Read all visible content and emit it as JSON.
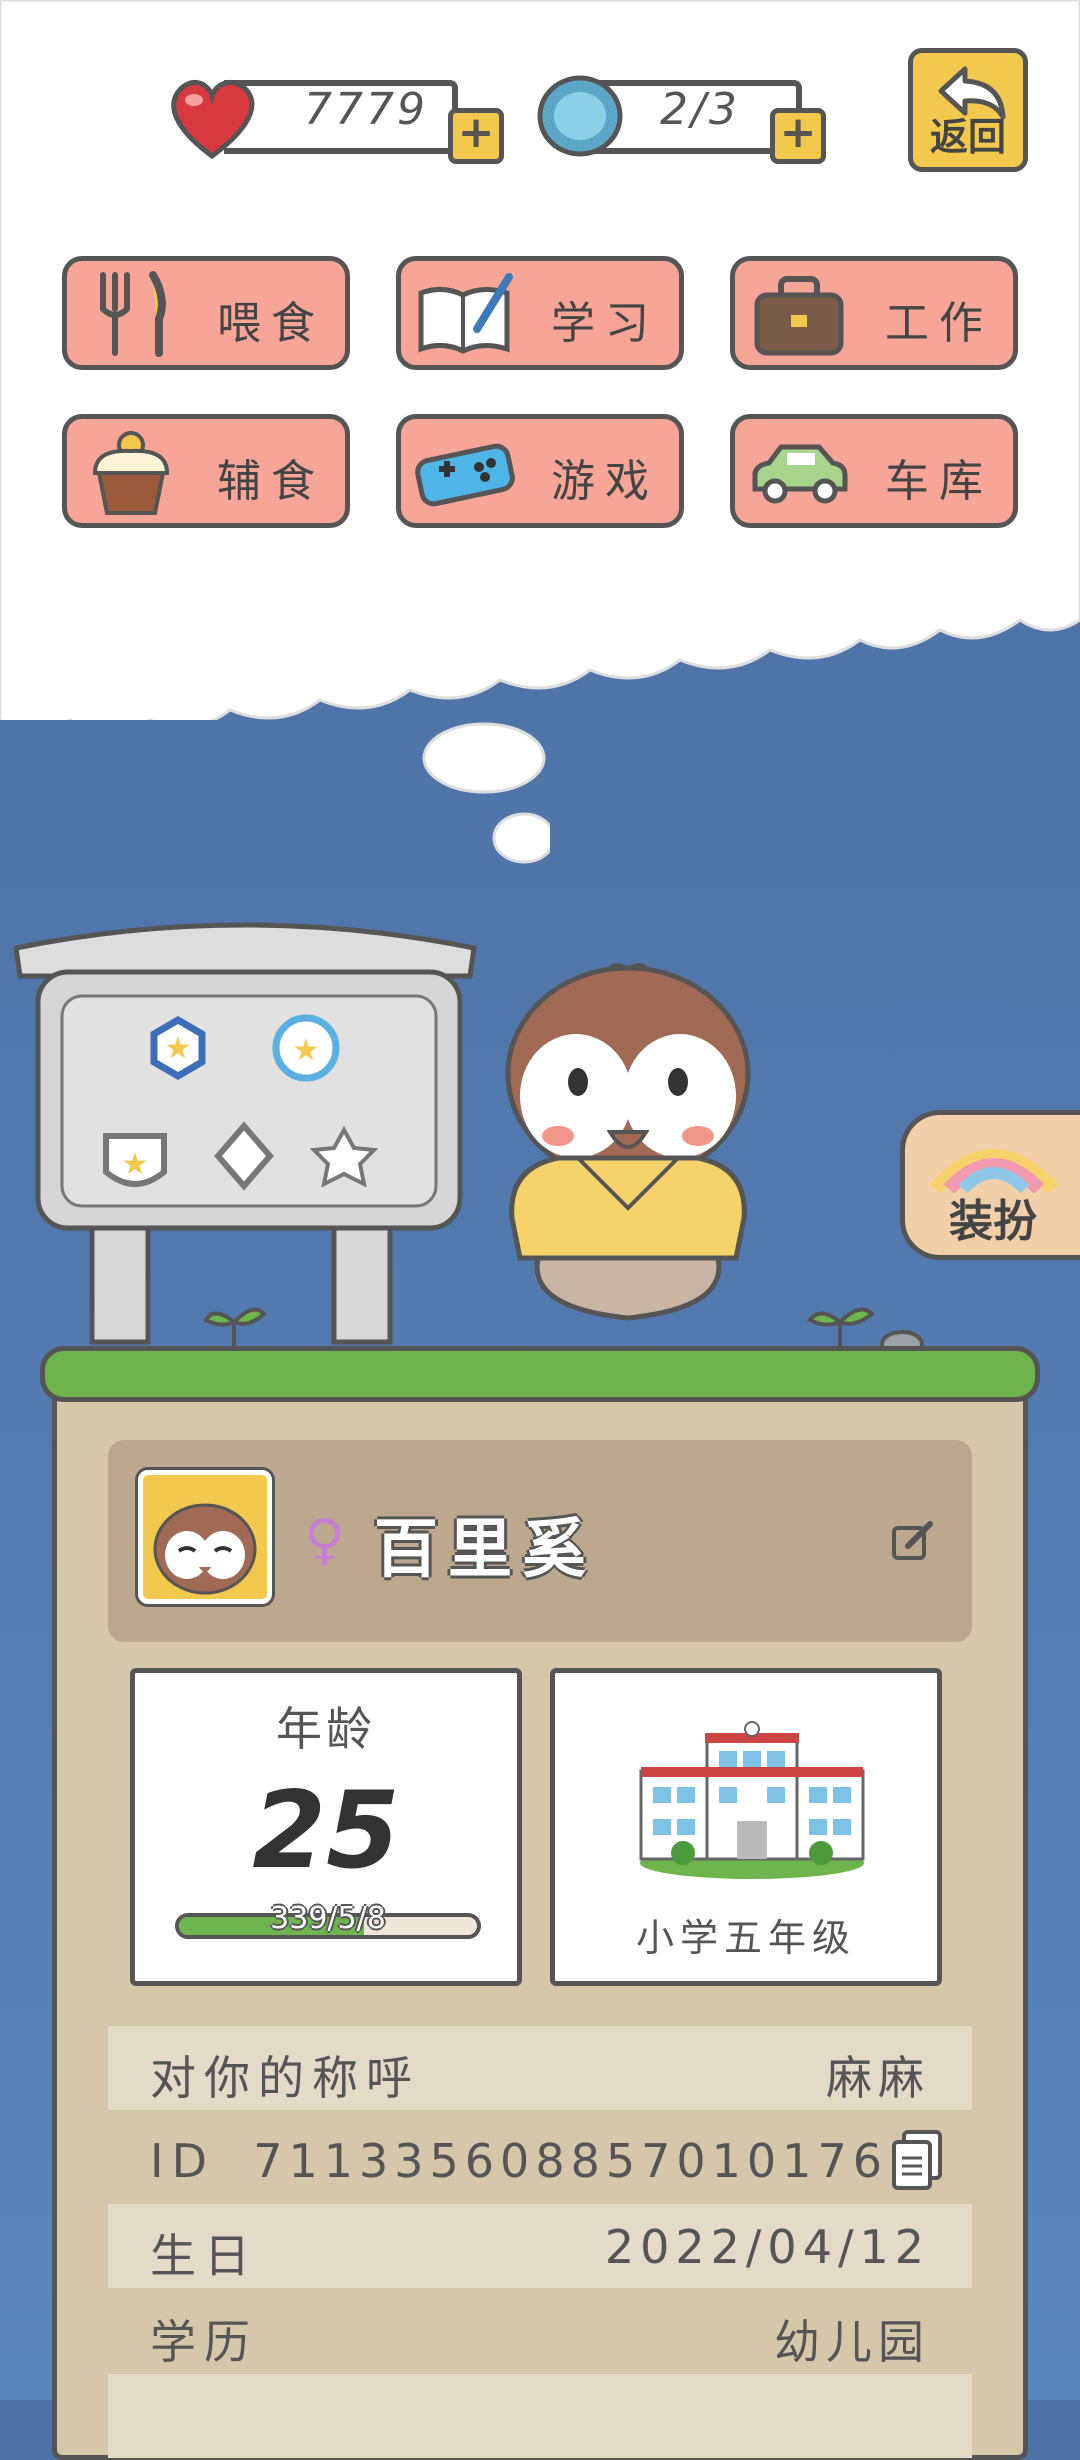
{
  "top_bar": {
    "hearts": "7779",
    "gems": "2/3",
    "back_label": "返回"
  },
  "menu": [
    {
      "label": "喂食",
      "icon": "fork-knife-icon"
    },
    {
      "label": "学习",
      "icon": "book-pen-icon"
    },
    {
      "label": "工作",
      "icon": "briefcase-icon"
    },
    {
      "label": "辅食",
      "icon": "cupcake-icon"
    },
    {
      "label": "游戏",
      "icon": "gamepad-icon"
    },
    {
      "label": "车库",
      "icon": "car-icon"
    }
  ],
  "dress_label": "装扮",
  "profile": {
    "name": "百里奚",
    "gender_symbol": "♀"
  },
  "age_card": {
    "title": "年龄",
    "age": "25",
    "progress_text": "339/5/8",
    "progress": 0.62
  },
  "school_card": {
    "label": "小学五年级"
  },
  "info_rows": [
    {
      "key": "对你的称呼",
      "value": "麻麻"
    },
    {
      "key": "ID",
      "value": "7113356088570​10176"
    },
    {
      "key": "生日",
      "value": "2022/04/12"
    },
    {
      "key": "学历",
      "value": "幼儿园"
    }
  ],
  "colors": {
    "accent_yellow": "#f2c94c",
    "button_pink": "#f7a597",
    "grass": "#6fb54e",
    "panel": "#d6c7ab",
    "sky": "#4f72a6"
  }
}
